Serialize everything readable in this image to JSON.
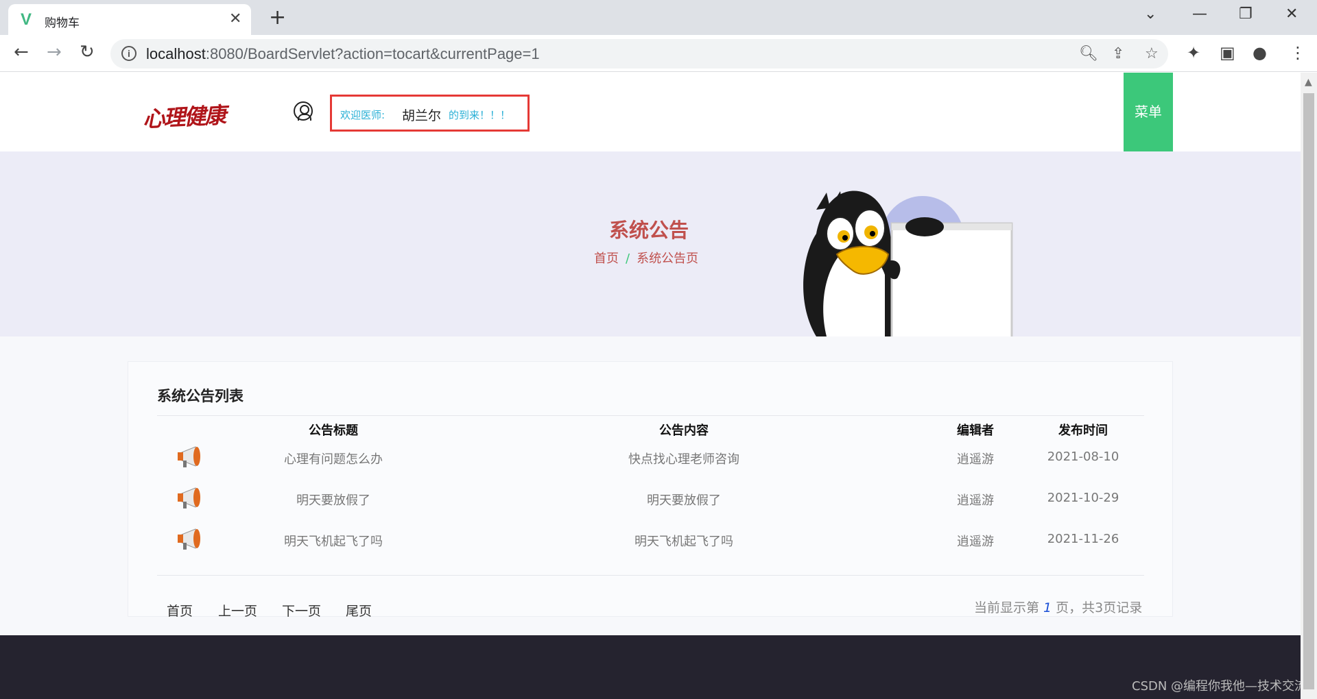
{
  "browser": {
    "tab_title": "购物车",
    "tab_favicon": "V",
    "url_host": "localhost",
    "url_rest": ":8080/BoardServlet?action=tocart&currentPage=1"
  },
  "header": {
    "logo_text": "心理健康",
    "welcome_prefix": "欢迎医师:",
    "user_name": "胡兰尔",
    "welcome_suffix": "的到来！！！",
    "menu_label": "菜单"
  },
  "banner": {
    "title": "系统公告",
    "breadcrumb_home": "首页",
    "breadcrumb_sep": "/",
    "breadcrumb_current": "系统公告页"
  },
  "notice_list": {
    "title": "系统公告列表",
    "columns": [
      "公告标题",
      "公告内容",
      "编辑者",
      "发布时间"
    ],
    "rows": [
      {
        "title": "心理有问题怎么办",
        "content": "快点找心理老师咨询",
        "editor": "逍遥游",
        "date": "2021-08-10"
      },
      {
        "title": "明天要放假了",
        "content": "明天要放假了",
        "editor": "逍遥游",
        "date": "2021-10-29"
      },
      {
        "title": "明天飞机起飞了吗",
        "content": "明天飞机起飞了吗",
        "editor": "逍遥游",
        "date": "2021-11-26"
      }
    ]
  },
  "pagination": {
    "first": "首页",
    "prev": "上一页",
    "next": "下一页",
    "last": "尾页",
    "info_prefix": "当前显示第",
    "current_page": "1",
    "info_suffix": "页，共3页记录"
  },
  "footer": {
    "watermark": "CSDN @编程你我他—技术交流"
  },
  "colors": {
    "menu_bg": "#3cc87a",
    "banner_bg": "#ececf7",
    "title_red": "#c0504d",
    "footer_bg": "#25232f",
    "welcome_border": "#e53935"
  }
}
